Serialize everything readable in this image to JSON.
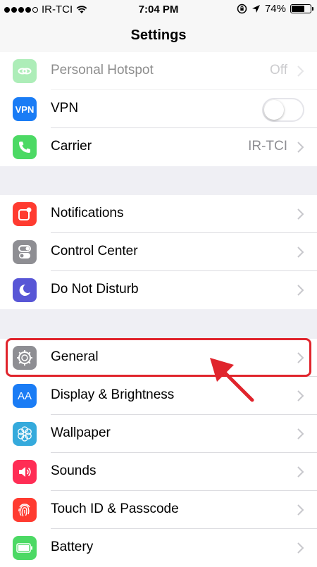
{
  "status_bar": {
    "signal_filled": 4,
    "signal_total": 5,
    "carrier": "IR-TCI",
    "time": "7:04 PM",
    "battery": "74%",
    "battery_level": 0.74
  },
  "nav": {
    "title": "Settings"
  },
  "groups": [
    {
      "rows": [
        {
          "label": "Personal Hotspot",
          "value": "Off",
          "icon": "hotspot-icon",
          "color": "#4cd964",
          "accessory": "chevron",
          "dimmed": true
        },
        {
          "label": "VPN",
          "icon_text": "VPN",
          "icon": "vpn-icon",
          "color": "#1a7cf5",
          "accessory": "toggle",
          "toggle_on": false
        },
        {
          "label": "Carrier",
          "value": "IR-TCI",
          "icon": "phone-icon",
          "color": "#4cd964",
          "accessory": "chevron"
        }
      ]
    },
    {
      "rows": [
        {
          "label": "Notifications",
          "icon": "notifications-icon",
          "color": "#ff3b30",
          "accessory": "chevron"
        },
        {
          "label": "Control Center",
          "icon": "control-center-icon",
          "color": "#8e8e93",
          "accessory": "chevron"
        },
        {
          "label": "Do Not Disturb",
          "icon": "moon-icon",
          "color": "#5856d6",
          "accessory": "chevron"
        }
      ]
    },
    {
      "rows": [
        {
          "label": "General",
          "icon": "gear-icon",
          "color": "#8e8e93",
          "accessory": "chevron",
          "highlighted": true
        },
        {
          "label": "Display & Brightness",
          "icon_text": "AA",
          "icon": "display-brightness-icon",
          "color": "#1a7cf5",
          "accessory": "chevron"
        },
        {
          "label": "Wallpaper",
          "icon": "wallpaper-icon",
          "color": "#35aadc",
          "accessory": "chevron"
        },
        {
          "label": "Sounds",
          "icon": "speaker-icon",
          "color": "#ff2d55",
          "accessory": "chevron"
        },
        {
          "label": "Touch ID & Passcode",
          "icon": "fingerprint-icon",
          "color": "#ff3b30",
          "accessory": "chevron"
        },
        {
          "label": "Battery",
          "icon": "battery-icon",
          "color": "#4cd964",
          "accessory": "chevron"
        }
      ]
    }
  ],
  "annotation": {
    "highlight_color": "#e0242c",
    "target": "General"
  }
}
